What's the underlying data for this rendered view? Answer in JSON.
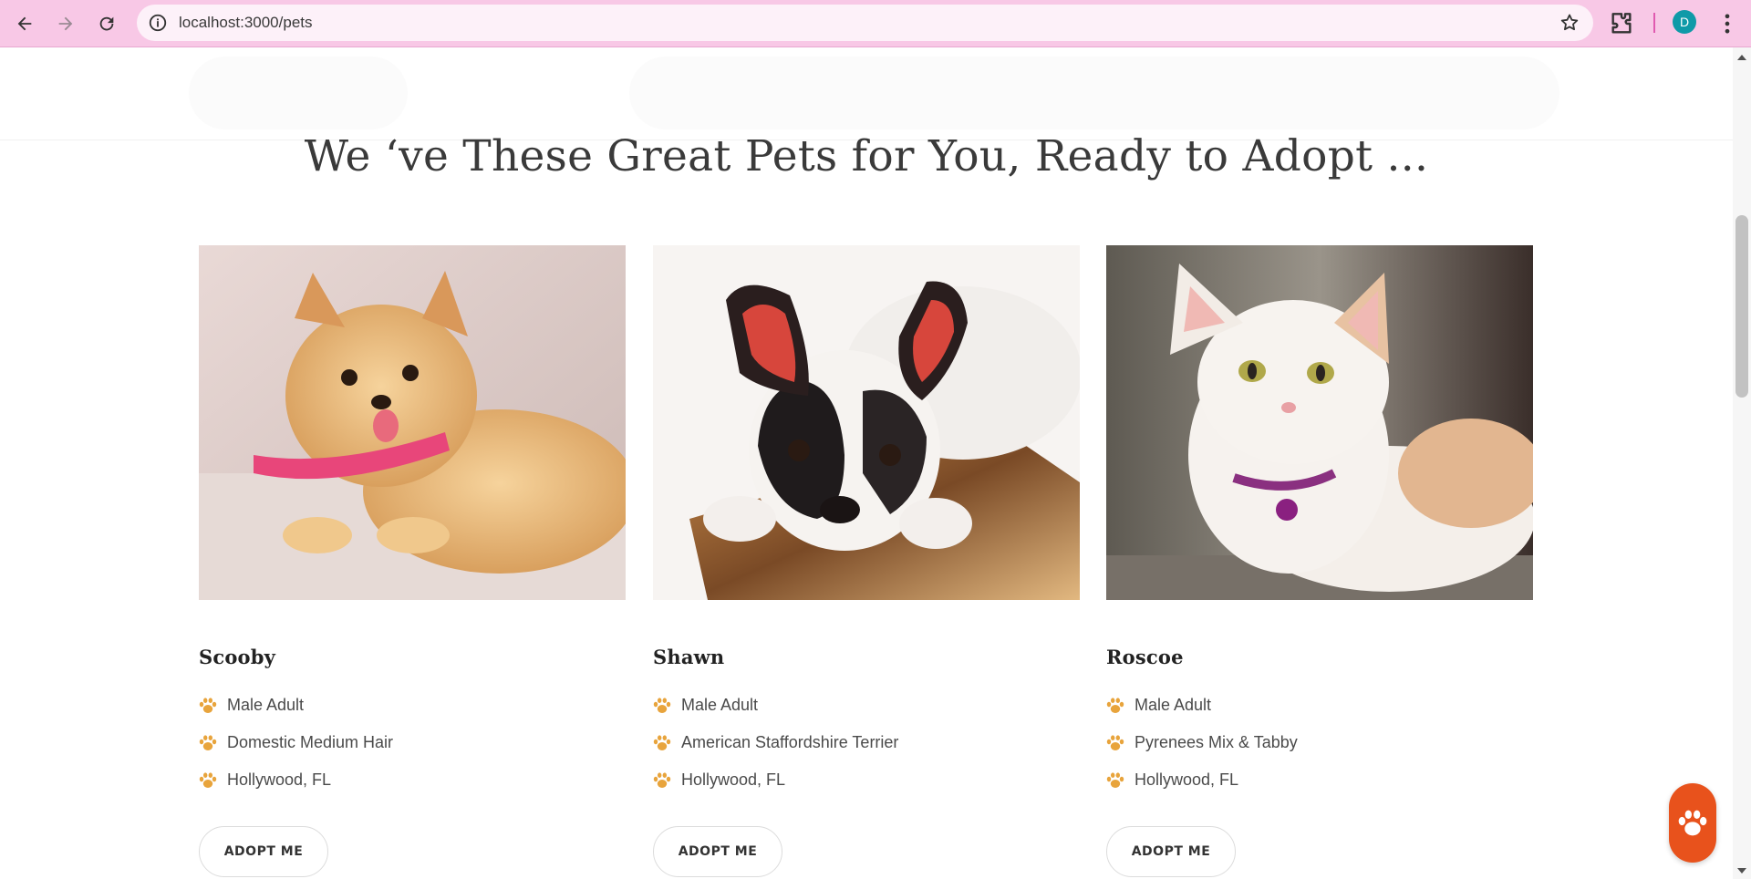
{
  "browser": {
    "url": "localhost:3000/pets",
    "profile_initial": "D"
  },
  "colors": {
    "chrome_bg": "#f8c8e6",
    "paw_accent": "#e8a43c",
    "fab_bg": "#e8521c"
  },
  "page": {
    "headline": "We ‘ve These Great Pets for You, Ready to Adopt ..."
  },
  "pets": [
    {
      "name": "Scooby",
      "image": "pomeranian-puppy-photo",
      "facts": [
        "Male Adult",
        "Domestic Medium Hair",
        "Hollywood, FL"
      ],
      "button": "ADOPT ME"
    },
    {
      "name": "Shawn",
      "image": "french-bulldog-photo",
      "facts": [
        "Male Adult",
        "American Staffordshire Terrier",
        "Hollywood, FL"
      ],
      "button": "ADOPT ME"
    },
    {
      "name": "Roscoe",
      "image": "white-ginger-cat-photo",
      "facts": [
        "Male Adult",
        "Pyrenees Mix & Tabby",
        "Hollywood, FL"
      ],
      "button": "ADOPT ME"
    }
  ],
  "icons": {
    "fact_bullet": "paw-icon",
    "fab": "paw-icon"
  }
}
